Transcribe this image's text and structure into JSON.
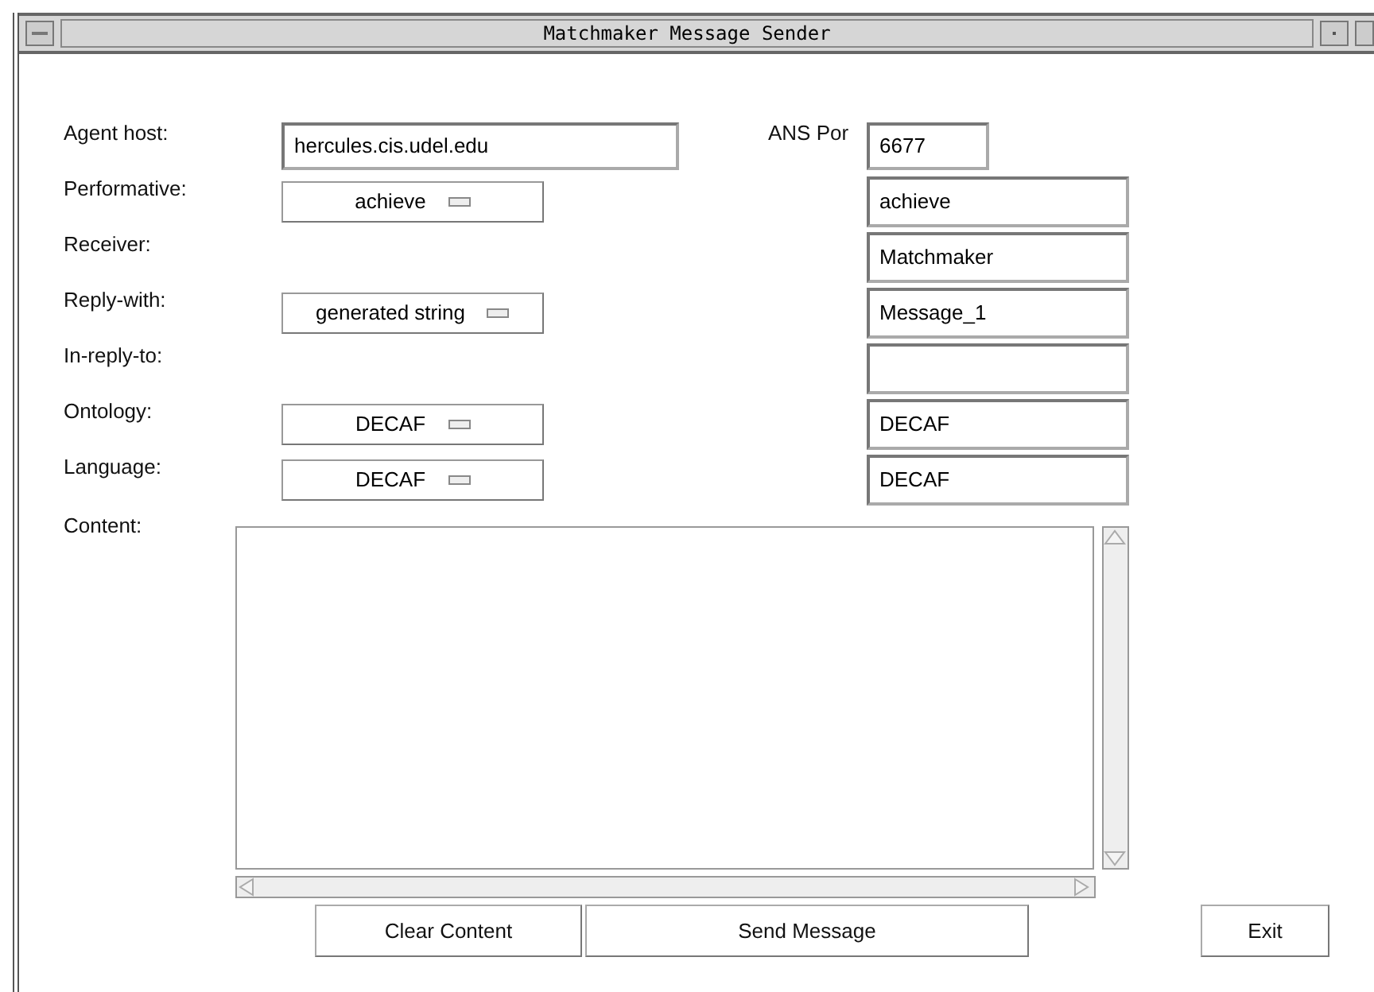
{
  "window": {
    "title": "Matchmaker Message Sender"
  },
  "agent_host": {
    "label": "Agent host:",
    "value": "hercules.cis.udel.edu"
  },
  "ans_port": {
    "label": "ANS Por",
    "value": "6677"
  },
  "fields": [
    {
      "label": "Performative:",
      "kind": "select",
      "value": "achieve",
      "right_value": "achieve"
    },
    {
      "label": "Receiver:",
      "kind": "none",
      "right_value": "Matchmaker"
    },
    {
      "label": "Reply-with:",
      "kind": "select",
      "value": "generated string",
      "right_value": "Message_1"
    },
    {
      "label": "In-reply-to:",
      "kind": "none"
    },
    {
      "label": "Ontology:",
      "kind": "select",
      "value": "DECAF",
      "right_value": "DECAF"
    },
    {
      "label": "Language:",
      "kind": "select",
      "value": "DECAF",
      "right_value": "DECAF"
    }
  ],
  "content": {
    "label": "Content:"
  },
  "buttons": [
    {
      "label": "Clear Content"
    },
    {
      "label": "Send Message"
    }
  ],
  "exit_button": {
    "label": "Exit"
  }
}
